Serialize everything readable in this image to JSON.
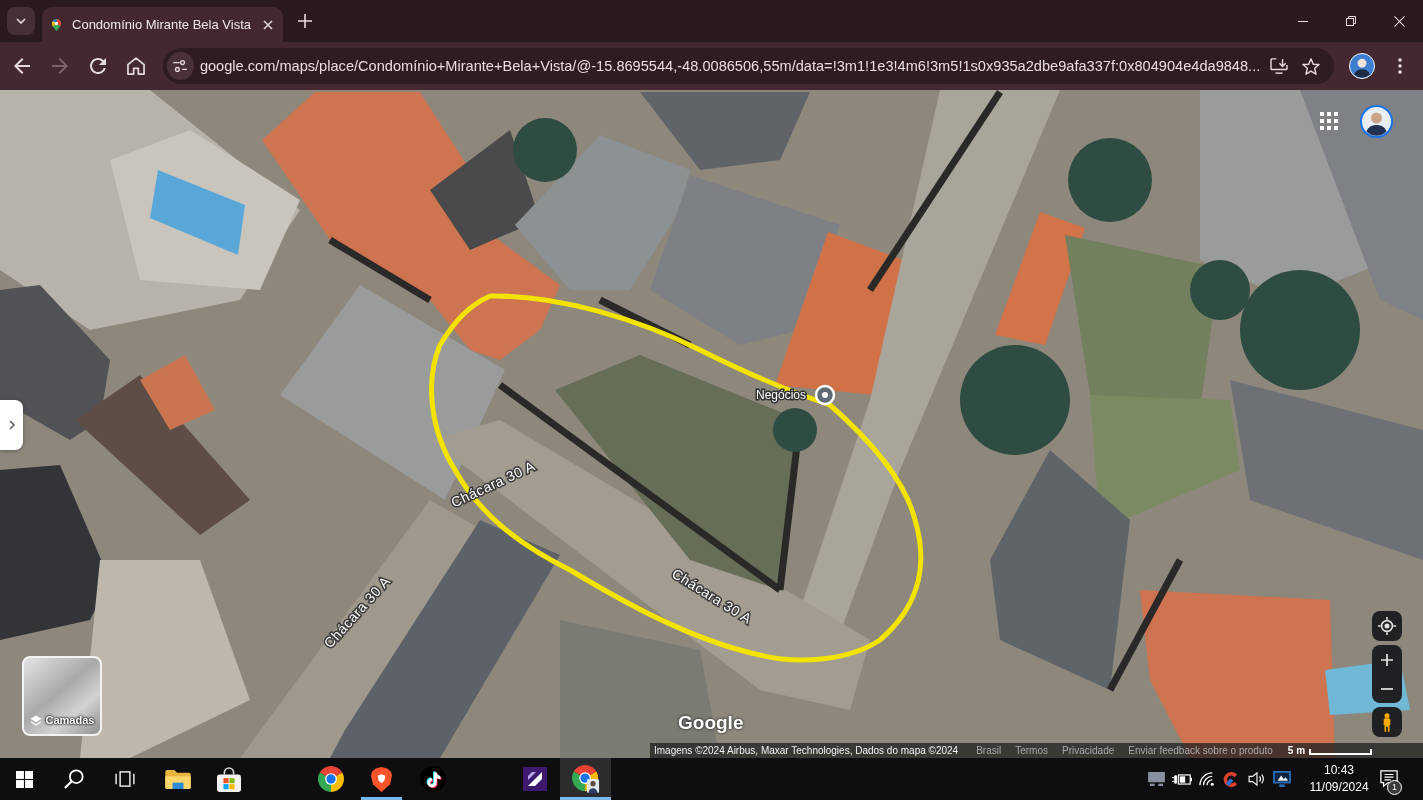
{
  "browser": {
    "tabs": [
      {
        "title": "Condomínio Mirante Bela Vista",
        "selected": true
      }
    ],
    "nav": [
      {
        "kind": "back",
        "disabled": false
      },
      {
        "kind": "forward",
        "disabled": true
      },
      {
        "kind": "reload",
        "disabled": false
      },
      {
        "kind": "home",
        "disabled": false
      }
    ],
    "address": "google.com/maps/place/Condomínio+Mirante+Bela+Vista/@-15.8695544,-48.0086506,55m/data=!3m1!1e3!4m6!3m5!1s0x935a2dbe9afa337f:0x804904e4da9848...",
    "bookmarked": false
  },
  "map": {
    "labels": [
      {
        "kind": "place",
        "text": "Negócios"
      },
      {
        "kind": "street",
        "text": "Chácara 30 A"
      },
      {
        "kind": "street",
        "text": "Chácara 30 A"
      },
      {
        "kind": "street",
        "text": "Chácara 30 A"
      }
    ],
    "layers_button": {
      "label": "Camadas"
    },
    "logo": "Google",
    "attribution": {
      "imagery": "Imagens ©2024 Airbus, Maxar Technologies, Dados do mapa ©2024",
      "links": [
        "Brasil",
        "Termos",
        "Privacidade",
        "Enviar feedback sobre o produto"
      ],
      "scale": "5 m"
    }
  },
  "taskbar": {
    "apps": [
      {
        "kind": "folder",
        "running": false,
        "selected": false
      },
      {
        "kind": "store",
        "running": false,
        "selected": false
      },
      {
        "kind": "chrome",
        "running": false,
        "selected": false
      },
      {
        "kind": "brave",
        "running": true,
        "selected": false
      },
      {
        "kind": "tiktok",
        "running": false,
        "selected": false
      },
      {
        "kind": "tile",
        "running": false,
        "selected": false
      },
      {
        "kind": "chromeprofile",
        "running": true,
        "selected": true
      }
    ],
    "clock": {
      "time": "10:43",
      "date": "11/09/2024"
    },
    "notifications": {
      "count": "1"
    }
  }
}
